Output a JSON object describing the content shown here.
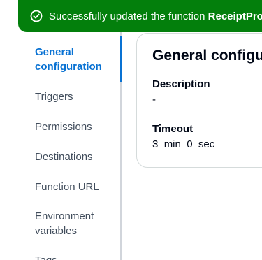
{
  "flash": {
    "message": "Successfully updated the function ",
    "function_name": "ReceiptProcessor",
    "status_color": "#037f0c",
    "icon": "success-check-icon"
  },
  "nav": {
    "items": [
      {
        "label": "General configuration",
        "active": true
      },
      {
        "label": "Triggers",
        "active": false
      },
      {
        "label": "Permissions",
        "active": false
      },
      {
        "label": "Destinations",
        "active": false
      },
      {
        "label": "Function URL",
        "active": false
      },
      {
        "label": "Environment variables",
        "active": false
      },
      {
        "label": "Tags",
        "active": false
      }
    ],
    "active_color": "#0972d3"
  },
  "card": {
    "title": "General configuration",
    "description_label": "Description",
    "description_value": "-",
    "timeout_label": "Timeout",
    "timeout_min_value": "3",
    "timeout_min_unit": "min",
    "timeout_sec_value": "0",
    "timeout_sec_unit": "sec"
  }
}
